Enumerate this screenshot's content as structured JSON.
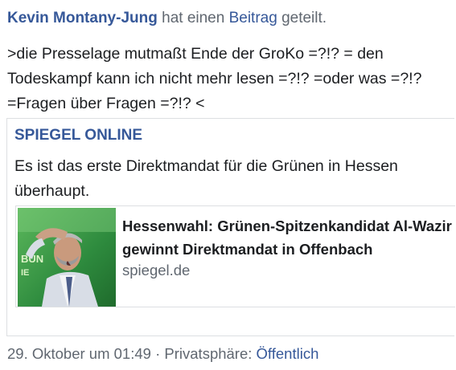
{
  "post": {
    "author": "Kevin Montany-Jung",
    "action_prefix": " hat einen ",
    "action_link": "Beitrag",
    "action_suffix": " geteilt.",
    "text": ">die Presselage mutmaßt Ende der GroKo =?!? = den Todeskampf kann ich nicht mehr lesen =?!? =oder was =?!? =Fragen über Fragen =?!? <"
  },
  "shared": {
    "source": "SPIEGEL ONLINE",
    "text": "Es ist das erste Direktmandat für die Grünen in Hessen überhaupt.",
    "link": {
      "title": "Hessenwahl: Grünen-Spitzenkandidat Al-Wazir gewinnt Direktmandat in Offenbach",
      "domain": "spiegel.de",
      "thumbnail_caption": "BÜN"
    }
  },
  "footer": {
    "timestamp": "29. Oktober um 01:49",
    "separator": " · ",
    "privacy_label": "Privatsphäre: ",
    "privacy_value": "Öffentlich"
  }
}
